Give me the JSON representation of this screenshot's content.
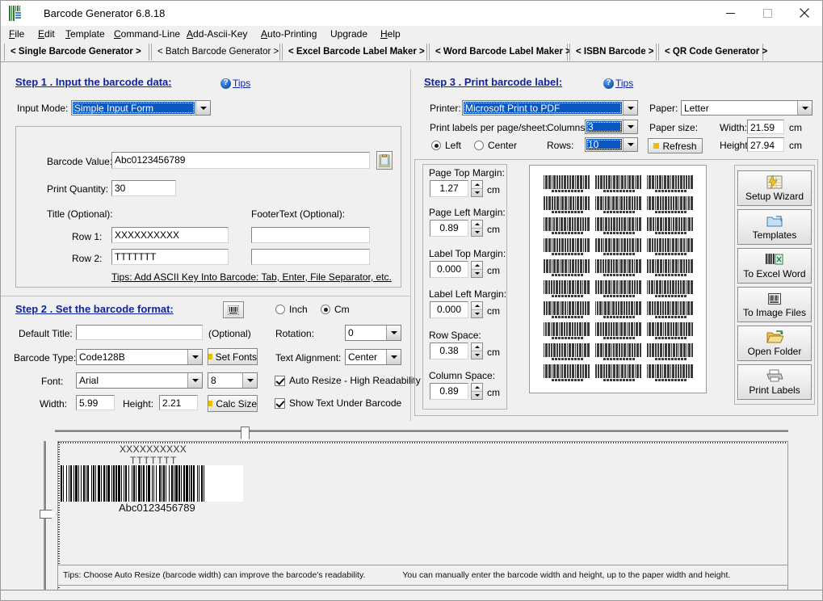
{
  "window": {
    "title": "Barcode Generator  6.8.18",
    "icon": "barcode-app-icon",
    "minimize": "minimize-icon",
    "maximize": "maximize-icon",
    "close": "close-icon"
  },
  "menu": [
    {
      "label": "File",
      "accel": "F"
    },
    {
      "label": "Edit",
      "accel": "E"
    },
    {
      "label": "Template",
      "accel": "T"
    },
    {
      "label": "Command-Line",
      "accel": "C"
    },
    {
      "label": "Add-Ascii-Key",
      "accel": "A"
    },
    {
      "label": "Auto-Printing",
      "accel": "A"
    },
    {
      "label": "Upgrade",
      "accel": ""
    },
    {
      "label": "Help",
      "accel": "H"
    }
  ],
  "tabs": [
    {
      "label": "< Single Barcode Generator >",
      "active": true
    },
    {
      "label": "< Batch Barcode Generator >",
      "active": false
    },
    {
      "label": "< Excel Barcode Label Maker >",
      "active": true
    },
    {
      "label": "< Word Barcode Label Maker >",
      "active": true
    },
    {
      "label": "< ISBN Barcode >",
      "active": true
    },
    {
      "label": "< QR Code Generator >",
      "active": true
    }
  ],
  "step1": {
    "title": "Step 1 .  Input the barcode data:",
    "tips": "Tips",
    "input_mode_label": "Input Mode:",
    "input_mode_value": "Simple Input Form",
    "barcode_value_label": "Barcode Value:",
    "barcode_value": "Abc0123456789",
    "paste_icon": "clipboard-icon",
    "print_quantity_label": "Print Quantity:",
    "print_quantity": "30",
    "title_optional_label": "Title (Optional):",
    "footer_optional_label": "FooterText (Optional):",
    "row1_label": "Row 1:",
    "row1_title": "XXXXXXXXXX",
    "row1_footer": "",
    "row2_label": "Row 2:",
    "row2_title": "TTTTTTT",
    "row2_footer": "",
    "ascii_tip": "Tips:  Add ASCII Key Into Barcode: Tab, Enter, File Separator, etc."
  },
  "step2": {
    "title": "Step 2 . Set the barcode format:",
    "barcode_icon": "barcode-icon",
    "unit_inch": "Inch",
    "unit_cm": "Cm",
    "unit_selected": "Cm",
    "default_title_label": "Default Title:",
    "default_title_value": "",
    "optional_note": "(Optional)",
    "barcode_type_label": "Barcode Type:",
    "barcode_type_value": "Code128B",
    "set_fonts_label": "Set Fonts",
    "font_label": "Font:",
    "font_value": "Arial",
    "font_size_value": "8",
    "width_label": "Width:",
    "width_value": "5.99",
    "height_label": "Height:",
    "height_value": "2.21",
    "calc_size_label": "Calc Size",
    "rotation_label": "Rotation:",
    "rotation_value": "0",
    "text_alignment_label": "Text Alignment:",
    "text_alignment_value": "Center",
    "auto_resize_label": "Auto Resize - High Readability",
    "auto_resize_checked": true,
    "show_text_label": "Show Text Under Barcode",
    "show_text_checked": true
  },
  "step3": {
    "title": "Step 3 . Print barcode label:",
    "tips": "Tips",
    "printer_label": "Printer:",
    "printer_value": "Microsoft Print to PDF",
    "paper_label": "Paper:",
    "paper_value": "Letter",
    "labels_per_sheet_label": "Print labels per page/sheet:",
    "columns_label": "Columns:",
    "columns_value": "3",
    "rows_label": "Rows:",
    "rows_value": "10",
    "align_left": "Left",
    "align_center": "Center",
    "align_selected": "Left",
    "paper_size_label": "Paper size:",
    "paper_width_label": "Width:",
    "paper_width_value": "21.59",
    "paper_height_label": "Height:",
    "paper_height_value": "27.94",
    "refresh_label": "Refresh",
    "unit_cm": "cm",
    "margins": [
      {
        "label": "Page Top Margin:",
        "value": "1.27",
        "unit": "cm"
      },
      {
        "label": "Page Left Margin:",
        "value": "0.89",
        "unit": "cm"
      },
      {
        "label": "Label Top Margin:",
        "value": "0.000",
        "unit": "cm"
      },
      {
        "label": "Label Left Margin:",
        "value": "0.000",
        "unit": "cm"
      },
      {
        "label": "Row Space:",
        "value": "0.38",
        "unit": "cm"
      },
      {
        "label": "Column Space:",
        "value": "0.89",
        "unit": "cm"
      }
    ],
    "tools": [
      {
        "label": "Setup Wizard",
        "icon": "setup-wizard-icon"
      },
      {
        "label": "Templates",
        "icon": "folder-template-icon"
      },
      {
        "label": "To Excel Word",
        "icon": "excel-export-icon"
      },
      {
        "label": "To Image Files",
        "icon": "image-export-icon"
      },
      {
        "label": "Open Folder",
        "icon": "open-folder-icon"
      },
      {
        "label": "Print Labels",
        "icon": "printer-icon"
      }
    ]
  },
  "preview": {
    "sheet_columns": 3,
    "sheet_rows": 10,
    "label_title": "XXXXXXXXXX",
    "label_subtitle": "TTTTTTT",
    "label_number": "Abc0123456789",
    "tips_left": "Tips:   Choose Auto Resize (barcode width)  can improve the barcode's readability.",
    "tips_right": "You can manually enter the barcode width and height, up to the paper width and height."
  },
  "colors": {
    "window_bg": "#f0f0f0",
    "step_title": "#11249e",
    "selection_blue": "#0a57c2",
    "accent_yellow": "#e8c000",
    "barcode_black": "#000000",
    "preview_bar": "#3b3b3b"
  }
}
